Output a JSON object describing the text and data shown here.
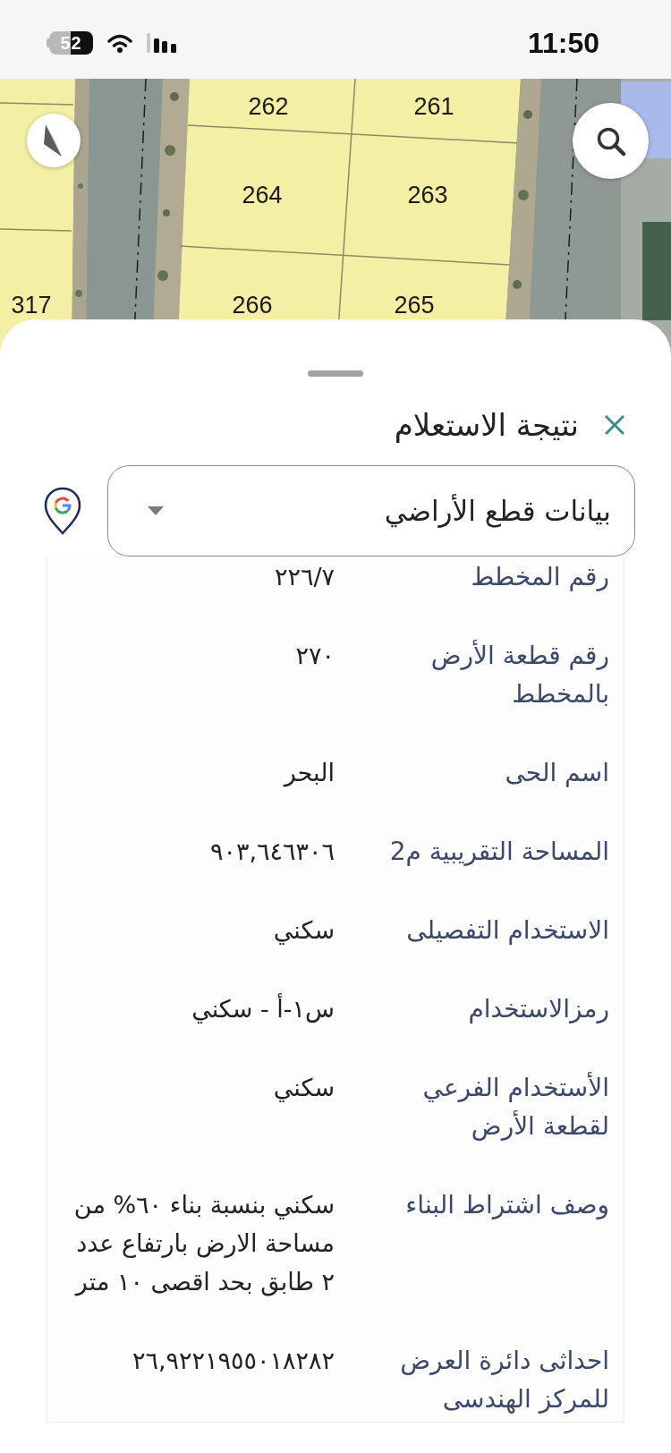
{
  "status_bar": {
    "battery": "52",
    "time": "11:50"
  },
  "map": {
    "parcels": [
      {
        "label": "261"
      },
      {
        "label": "262"
      },
      {
        "label": "263"
      },
      {
        "label": "264"
      },
      {
        "label": "265"
      },
      {
        "label": "266"
      },
      {
        "label": "317"
      }
    ]
  },
  "sheet": {
    "title": "نتيجة الاستعلام",
    "dropdown": {
      "value": "بيانات قطع الأراضي"
    },
    "rows": [
      {
        "label": "رقم المخطط",
        "value": "٢٢٦/٧"
      },
      {
        "label": "رقم قطعة الأرض بالمخطط",
        "value": "٢٧٠"
      },
      {
        "label": "اسم الحى",
        "value": "البحر"
      },
      {
        "label": "المساحة التقريبية م2",
        "value": "٩٠٣,٦٤٦٣٠٦"
      },
      {
        "label": "الاستخدام التفصيلى",
        "value": "سكني"
      },
      {
        "label": "رمزالاستخدام",
        "value": "س١-أ - سكني"
      },
      {
        "label": "الأستخدام الفرعي لقطعة الأرض",
        "value": "سكني"
      },
      {
        "label": "وصف اشتراط البناء",
        "value": "سكني بنسبة بناء ٦٠% من مساحة الارض بارتفاع عدد ٢ طابق بحد اقصى ١٠ متر"
      },
      {
        "label": "احداثى دائرة العرض للمركز الهندسى",
        "value": "٢٦,٩٢٢١٩٥٥٠١٨٢٨٢"
      }
    ]
  }
}
